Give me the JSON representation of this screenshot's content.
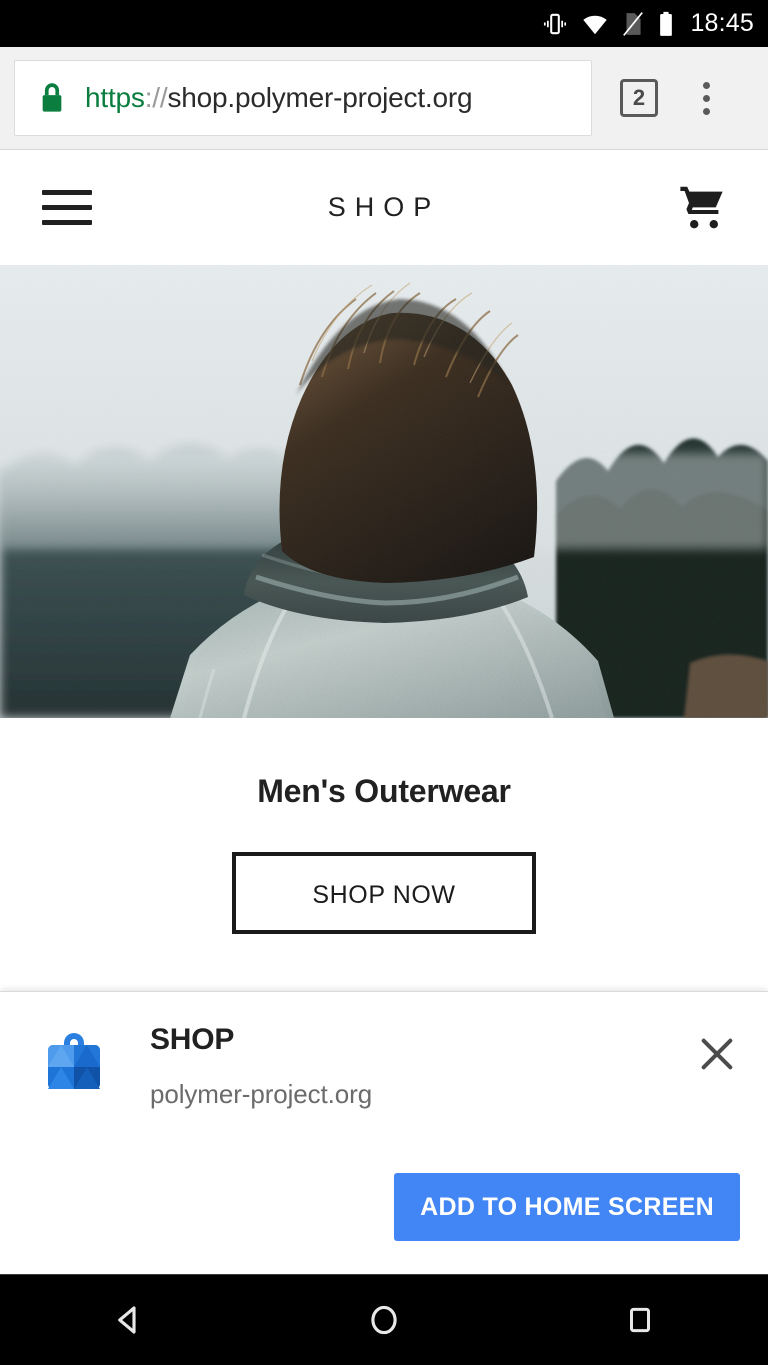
{
  "status_bar": {
    "clock": "18:45",
    "icons": [
      "vibrate-icon",
      "wifi-icon",
      "no-sim-icon",
      "battery-icon"
    ]
  },
  "browser": {
    "url_scheme": "https",
    "url_separator": "://",
    "url_host": "shop.polymer-project.org",
    "url_full": "https://shop.polymer-project.org",
    "tab_count": "2",
    "lock_icon": "lock-icon",
    "menu_icon": "overflow-menu-icon",
    "colors": {
      "chrome_bg": "#f1f1f1",
      "scheme_green": "#0b7d3e",
      "omnibox_bg": "#ffffff"
    }
  },
  "site": {
    "title": "SHOP",
    "menu_icon": "hamburger-menu-icon",
    "cart_icon": "shopping-cart-icon",
    "hero": {
      "alt": "man-in-grey-outerwear-facing-misty-forest"
    },
    "category": {
      "title": "Men's Outerwear",
      "cta_label": "SHOP NOW"
    }
  },
  "install_banner": {
    "app_name": "SHOP",
    "origin": "polymer-project.org",
    "app_icon": "shopping-bag-app-icon",
    "close_icon": "close-icon",
    "primary_action": "ADD TO HOME SCREEN",
    "colors": {
      "button_blue": "#4285f4",
      "origin_grey": "#6b6b6b"
    }
  },
  "nav_bar": {
    "back": "back-triangle-icon",
    "home": "home-circle-icon",
    "recents": "recents-square-icon"
  }
}
